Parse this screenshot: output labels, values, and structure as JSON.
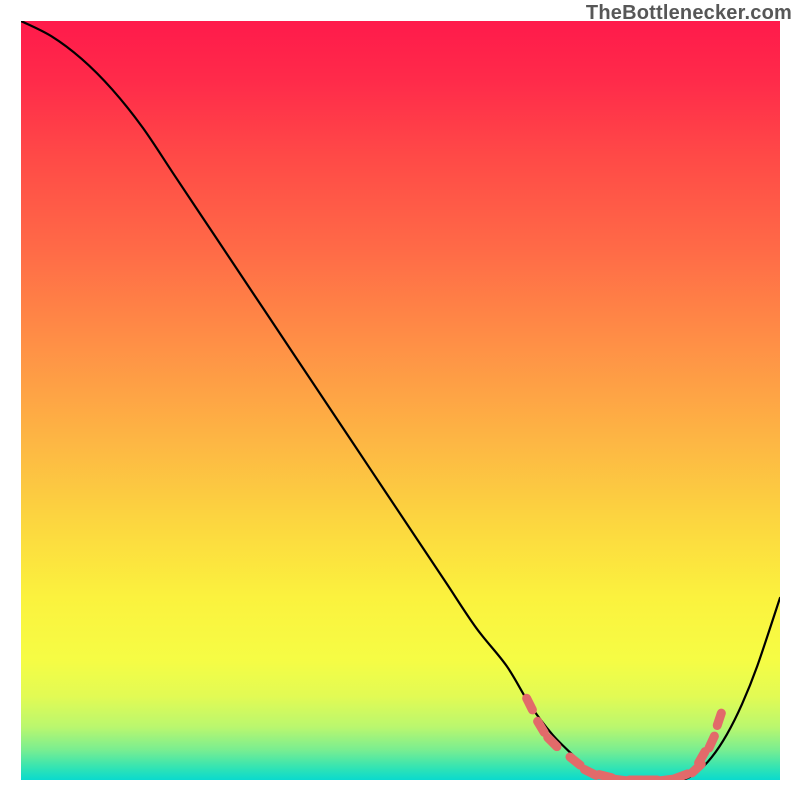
{
  "watermark": "TheBottlenecker.com",
  "chart_data": {
    "type": "line",
    "title": "",
    "xlabel": "",
    "ylabel": "",
    "xlim": [
      0,
      100
    ],
    "ylim": [
      0,
      100
    ],
    "grid": false,
    "series": [
      {
        "name": "curve",
        "color": "#000000",
        "x": [
          0,
          4,
          8,
          12,
          16,
          20,
          24,
          28,
          32,
          36,
          40,
          44,
          48,
          52,
          56,
          60,
          64,
          67,
          70,
          73,
          75,
          78,
          81,
          84,
          87,
          89,
          91,
          93,
          95,
          97,
          100
        ],
        "y": [
          100,
          98,
          95,
          91,
          86,
          80,
          74,
          68,
          62,
          56,
          50,
          44,
          38,
          32,
          26,
          20,
          15,
          10,
          6,
          3,
          1,
          0,
          0,
          0,
          0,
          1,
          3,
          6,
          10,
          15,
          24
        ]
      }
    ],
    "markers": {
      "color": "#e26a6a",
      "points": [
        {
          "x": 67,
          "y": 10
        },
        {
          "x": 68.5,
          "y": 7
        },
        {
          "x": 70,
          "y": 5
        },
        {
          "x": 73,
          "y": 2.5
        },
        {
          "x": 75,
          "y": 1
        },
        {
          "x": 77,
          "y": 0.5
        },
        {
          "x": 79,
          "y": 0
        },
        {
          "x": 81,
          "y": 0
        },
        {
          "x": 83,
          "y": 0
        },
        {
          "x": 85,
          "y": 0
        },
        {
          "x": 87,
          "y": 0.5
        },
        {
          "x": 89,
          "y": 1.5
        },
        {
          "x": 89.7,
          "y": 3
        },
        {
          "x": 91,
          "y": 5
        },
        {
          "x": 92,
          "y": 8
        }
      ]
    },
    "gradient_stops": [
      {
        "offset": 0.0,
        "color": "#ff1a4b"
      },
      {
        "offset": 0.08,
        "color": "#ff2b4a"
      },
      {
        "offset": 0.18,
        "color": "#ff4a47"
      },
      {
        "offset": 0.3,
        "color": "#ff6a47"
      },
      {
        "offset": 0.42,
        "color": "#ff8e46"
      },
      {
        "offset": 0.55,
        "color": "#fdb544"
      },
      {
        "offset": 0.67,
        "color": "#fcd93f"
      },
      {
        "offset": 0.76,
        "color": "#fbf23e"
      },
      {
        "offset": 0.84,
        "color": "#f6fc44"
      },
      {
        "offset": 0.89,
        "color": "#e2fb54"
      },
      {
        "offset": 0.93,
        "color": "#baf76e"
      },
      {
        "offset": 0.96,
        "color": "#7aee90"
      },
      {
        "offset": 0.985,
        "color": "#2fe3b5"
      },
      {
        "offset": 1.0,
        "color": "#0adace"
      }
    ]
  }
}
